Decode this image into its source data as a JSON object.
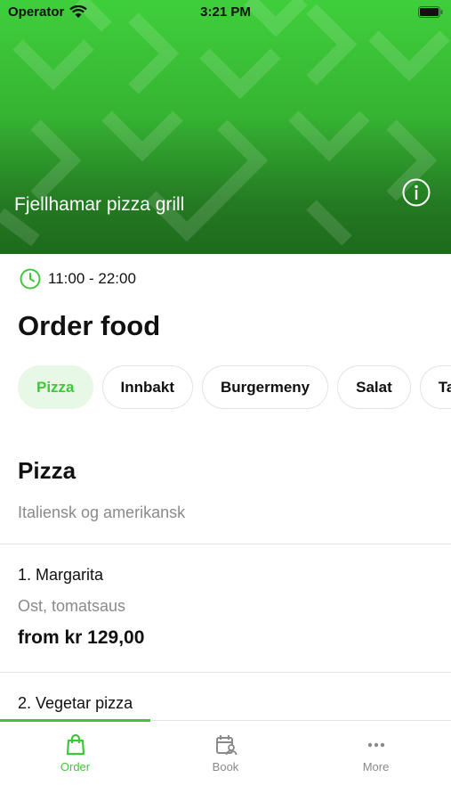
{
  "status_bar": {
    "carrier": "Operator",
    "time": "3:21 PM"
  },
  "hero": {
    "restaurant_name": "Fjellhamar pizza grill"
  },
  "hours": "11:00 - 22:00",
  "page_title": "Order food",
  "categories": [
    {
      "label": "Pizza",
      "active": true
    },
    {
      "label": "Innbakt",
      "active": false
    },
    {
      "label": "Burgermeny",
      "active": false
    },
    {
      "label": "Salat",
      "active": false
    },
    {
      "label": "Ta",
      "active": false
    }
  ],
  "section": {
    "title": "Pizza",
    "subtitle": "Italiensk og amerikansk"
  },
  "items": [
    {
      "name": "1. Margarita",
      "description": "Ost, tomatsaus",
      "price": "from kr 129,00"
    },
    {
      "name": "2. Vegetar pizza"
    }
  ],
  "tabs": [
    {
      "label": "Order",
      "icon": "shopping-bag-icon",
      "active": true
    },
    {
      "label": "Book",
      "icon": "calendar-person-icon",
      "active": false
    },
    {
      "label": "More",
      "icon": "more-dots-icon",
      "active": false
    }
  ],
  "colors": {
    "accent": "#41c63b",
    "chip_active_bg": "#e7f8e6",
    "text_secondary": "#8a8a8a"
  }
}
